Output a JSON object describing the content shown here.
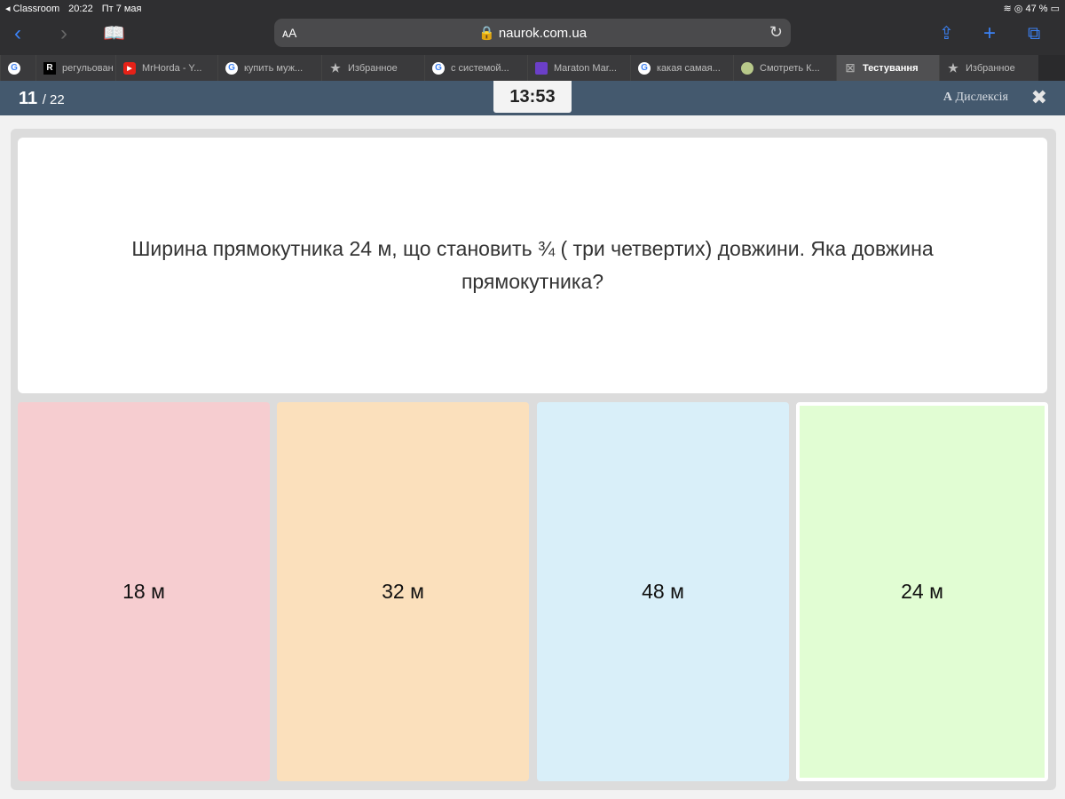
{
  "status_bar": {
    "back_app": "◂ Classroom",
    "time": "20:22",
    "date": "Пт 7 мая",
    "battery": "47 %"
  },
  "browser": {
    "aa": "ᴀA",
    "url": "naurok.com.ua"
  },
  "tabs": [
    {
      "label": "",
      "icon": "G"
    },
    {
      "label": "регульован",
      "icon": "R"
    },
    {
      "label": "MrHorda - Y...",
      "icon": "▶"
    },
    {
      "label": "купить муж...",
      "icon": "G"
    },
    {
      "label": "Избранное",
      "icon": "★"
    },
    {
      "label": "с системой...",
      "icon": "G"
    },
    {
      "label": "Maraton Mar...",
      "icon": "■"
    },
    {
      "label": "какая самая...",
      "icon": "G"
    },
    {
      "label": "Смотреть К...",
      "icon": "●"
    },
    {
      "label": "Тестування",
      "icon": "☒"
    },
    {
      "label": "Избранное",
      "icon": "★"
    }
  ],
  "quiz": {
    "current": "11",
    "total": "/ 22",
    "timer": "13:53",
    "dyslexia": "Дислексія",
    "question": "Ширина прямокутника 24 м, що становить ¾ ( три четвертих) довжини. Яка довжина прямокутника?",
    "answers": [
      {
        "label": "18 м",
        "color": "#f6cdd0"
      },
      {
        "label": "32 м",
        "color": "#fbe0bc"
      },
      {
        "label": "48 м",
        "color": "#d9eff9"
      },
      {
        "label": "24 м",
        "color": "#e1fdd3"
      }
    ]
  }
}
